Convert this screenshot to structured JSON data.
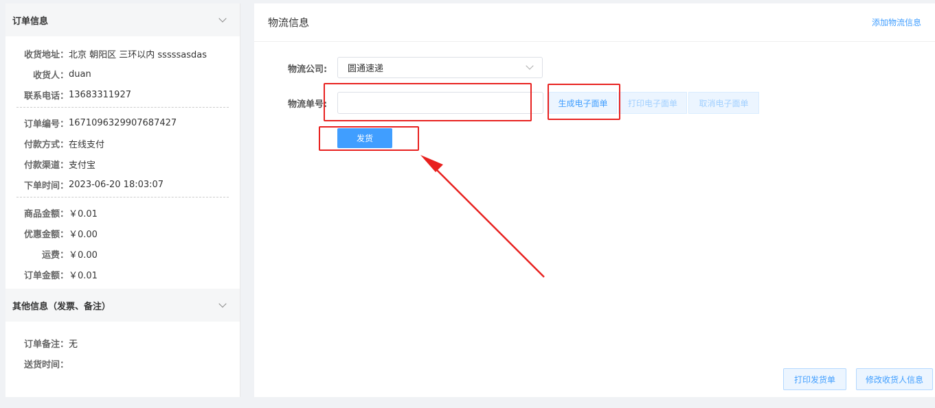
{
  "order_info": {
    "title": "订单信息",
    "address_label": "收货地址：",
    "address": "北京 朝阳区 三环以内 sssssasdas",
    "receiver_label": "收货人：",
    "receiver": "duan",
    "phone_label": "联系电话：",
    "phone": "13683311927",
    "order_no_label": "订单编号：",
    "order_no": "1671096329907687427",
    "pay_method_label": "付款方式：",
    "pay_method": "在线支付",
    "pay_channel_label": "付款渠道：",
    "pay_channel": "支付宝",
    "order_time_label": "下单时间：",
    "order_time": "2023-06-20 18:03:07",
    "goods_amount_label": "商品金额：",
    "goods_amount": "￥0.01",
    "discount_label": "优惠金额：",
    "discount": "￥0.00",
    "freight_label": "运费：",
    "freight": "￥0.00",
    "total_label": "订单金额：",
    "total": "￥0.01"
  },
  "other_info": {
    "title": "其他信息（发票、备注）",
    "remark_label": "订单备注：",
    "remark": "无",
    "delivery_time_label": "送货时间：",
    "delivery_time": ""
  },
  "logistics": {
    "title": "物流信息",
    "add_link": "添加物流信息",
    "company_label": "物流公司:",
    "company_value": "圆通速递",
    "tracking_label": "物流单号:",
    "tracking_value": "",
    "gen_button": "生成电子面单",
    "print_button": "打印电子面单",
    "cancel_button": "取消电子面单",
    "ship_button": "发货"
  },
  "footer": {
    "print_ship_button": "打印发货单",
    "edit_receiver_button": "修改收货人信息"
  },
  "annotation_color": "#e8201e"
}
